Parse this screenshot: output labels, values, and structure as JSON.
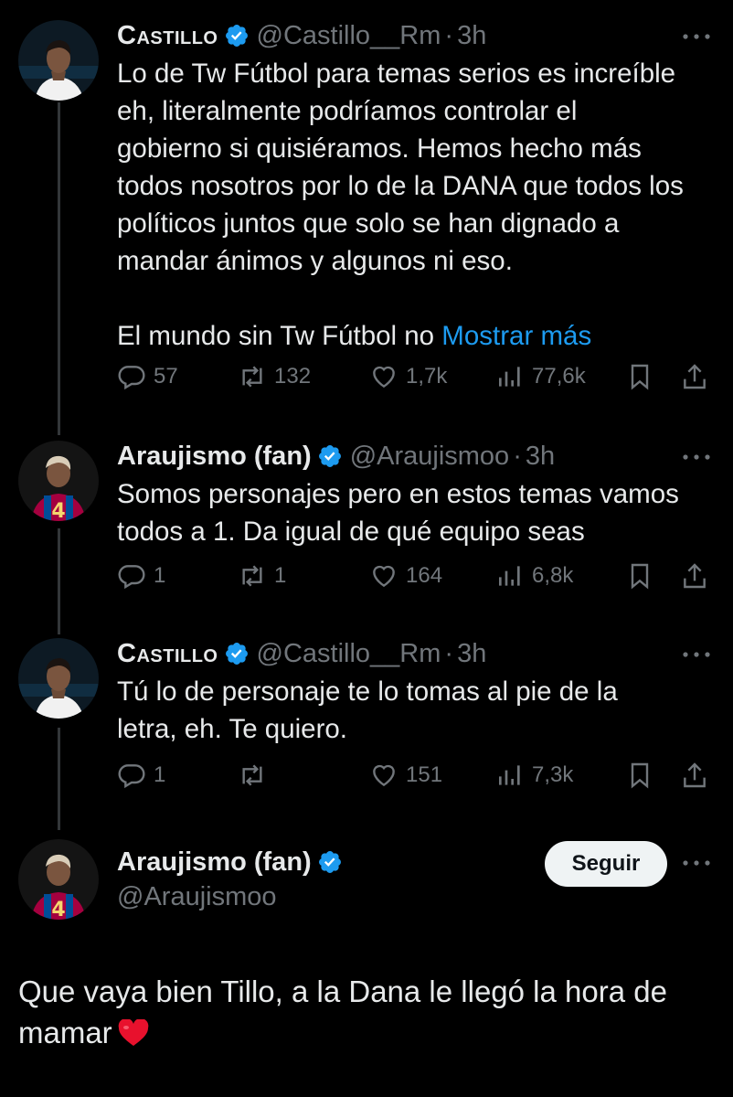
{
  "tweets": [
    {
      "name": "Castillo",
      "handle": "@Castillo__Rm",
      "dot": "·",
      "time": "3h",
      "avatar": "player-white-jersey-avatar",
      "text_lines": [
        "Lo de Tw Fútbol para temas serios es increíble",
        "eh, literalmente podríamos controlar el",
        "gobierno si quisiéramos. Hemos hecho más",
        "todos nosotros por lo de la DANA que todos los",
        "políticos juntos que solo se han dignado a",
        "mandar ánimos y algunos ni eso."
      ],
      "text_tail": "El mundo sin Tw Fútbol no ",
      "show_more": "Mostrar más",
      "replies": "57",
      "retweets": "132",
      "likes": "1,7k",
      "views": "77,6k"
    },
    {
      "name": "Araujismo (fan)",
      "handle": "@Araujismoo",
      "dot": "·",
      "time": "3h",
      "avatar": "player-barca-jersey-avatar",
      "text_lines": [
        "Somos personajes pero en estos temas vamos",
        "todos a 1. Da igual de qué equipo seas"
      ],
      "replies": "1",
      "retweets": "1",
      "likes": "164",
      "views": "6,8k"
    },
    {
      "name": "Castillo",
      "handle": "@Castillo__Rm",
      "dot": "·",
      "time": "3h",
      "avatar": "player-white-jersey-avatar",
      "text_lines": [
        "Tú lo de personaje te lo tomas al pie de la",
        "letra, eh. Te quiero."
      ],
      "replies": "1",
      "retweets": "",
      "likes": "151",
      "views": "7,3k"
    }
  ],
  "main_tweet": {
    "name": "Araujismo (fan)",
    "handle": "@Araujismoo",
    "follow_label": "Seguir",
    "text_line1": "Que vaya bien Tillo, a la Dana le llegó la hora de",
    "text_line2": "mamar",
    "emoji": "red-heart-icon"
  },
  "colors": {
    "background": "#000000",
    "text": "#e7e9ea",
    "muted": "#71767b",
    "link": "#1d9bf0",
    "verified": "#1d9bf0",
    "heart": "#e8112d"
  }
}
